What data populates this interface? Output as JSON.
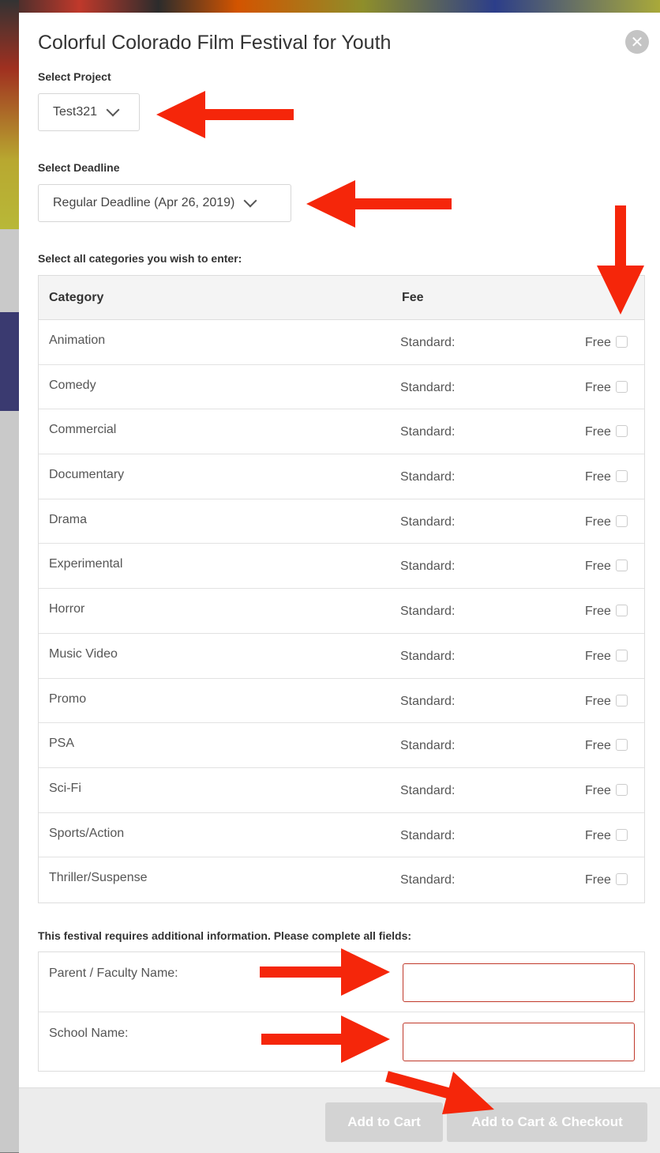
{
  "modal": {
    "title": "Colorful Colorado Film Festival for Youth",
    "close_icon": "close-icon"
  },
  "project": {
    "label": "Select Project",
    "value": "Test321"
  },
  "deadline": {
    "label": "Select Deadline",
    "value": "Regular Deadline (Apr 26, 2019)"
  },
  "categories": {
    "label": "Select all categories you wish to enter:",
    "header_category": "Category",
    "header_fee": "Fee",
    "rows": [
      {
        "name": "Animation",
        "fee_label": "Standard:",
        "fee": "Free"
      },
      {
        "name": "Comedy",
        "fee_label": "Standard:",
        "fee": "Free"
      },
      {
        "name": "Commercial",
        "fee_label": "Standard:",
        "fee": "Free"
      },
      {
        "name": "Documentary",
        "fee_label": "Standard:",
        "fee": "Free"
      },
      {
        "name": "Drama",
        "fee_label": "Standard:",
        "fee": "Free"
      },
      {
        "name": "Experimental",
        "fee_label": "Standard:",
        "fee": "Free"
      },
      {
        "name": "Horror",
        "fee_label": "Standard:",
        "fee": "Free"
      },
      {
        "name": "Music Video",
        "fee_label": "Standard:",
        "fee": "Free"
      },
      {
        "name": "Promo",
        "fee_label": "Standard:",
        "fee": "Free"
      },
      {
        "name": "PSA",
        "fee_label": "Standard:",
        "fee": "Free"
      },
      {
        "name": "Sci-Fi",
        "fee_label": "Standard:",
        "fee": "Free"
      },
      {
        "name": "Sports/Action",
        "fee_label": "Standard:",
        "fee": "Free"
      },
      {
        "name": "Thriller/Suspense",
        "fee_label": "Standard:",
        "fee": "Free"
      }
    ]
  },
  "additional": {
    "label": "This festival requires additional information. Please complete all fields:",
    "fields": [
      {
        "label": "Parent / Faculty Name:",
        "value": ""
      },
      {
        "label": "School Name:",
        "value": ""
      }
    ]
  },
  "footer": {
    "add_to_cart": "Add to Cart",
    "add_to_cart_checkout": "Add to Cart & Checkout"
  },
  "colors": {
    "annotation_arrow": "#f5260a",
    "input_error_border": "#c0392b",
    "disabled_button": "#d3d3d3"
  }
}
